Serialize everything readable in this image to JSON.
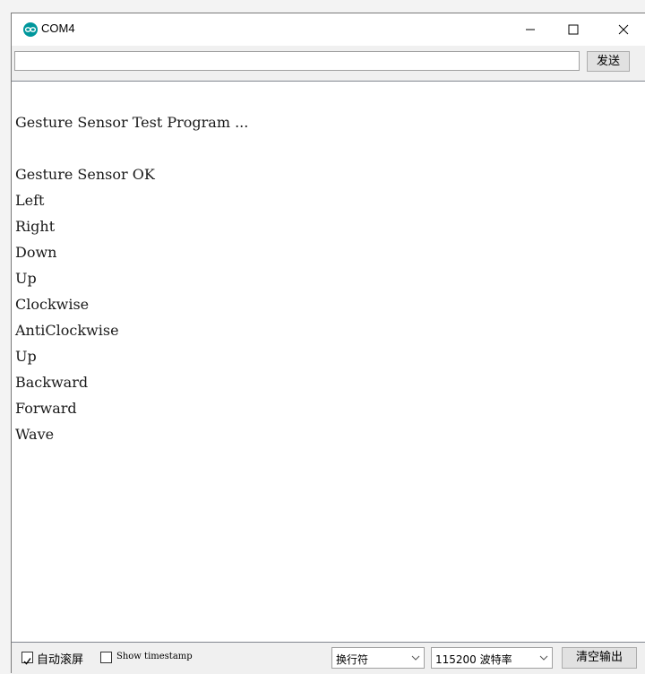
{
  "window": {
    "title": "COM4"
  },
  "send": {
    "input_value": "",
    "button_label": "发送"
  },
  "output": {
    "lines": [
      "Gesture Sensor Test Program ...",
      "Gesture Sensor OK",
      "Left",
      "Right",
      "Down",
      "Up",
      "Clockwise",
      "AntiClockwise",
      "Up",
      "Backward",
      "Forward",
      "Wave"
    ]
  },
  "status": {
    "autoscroll_label": "自动滚屏",
    "autoscroll_checked": true,
    "timestamp_label": "Show timestamp",
    "timestamp_checked": false,
    "line_ending": "换行符",
    "baud": "115200 波特率",
    "clear_label": "清空输出"
  },
  "colors": {
    "app_icon": "#00979c"
  }
}
